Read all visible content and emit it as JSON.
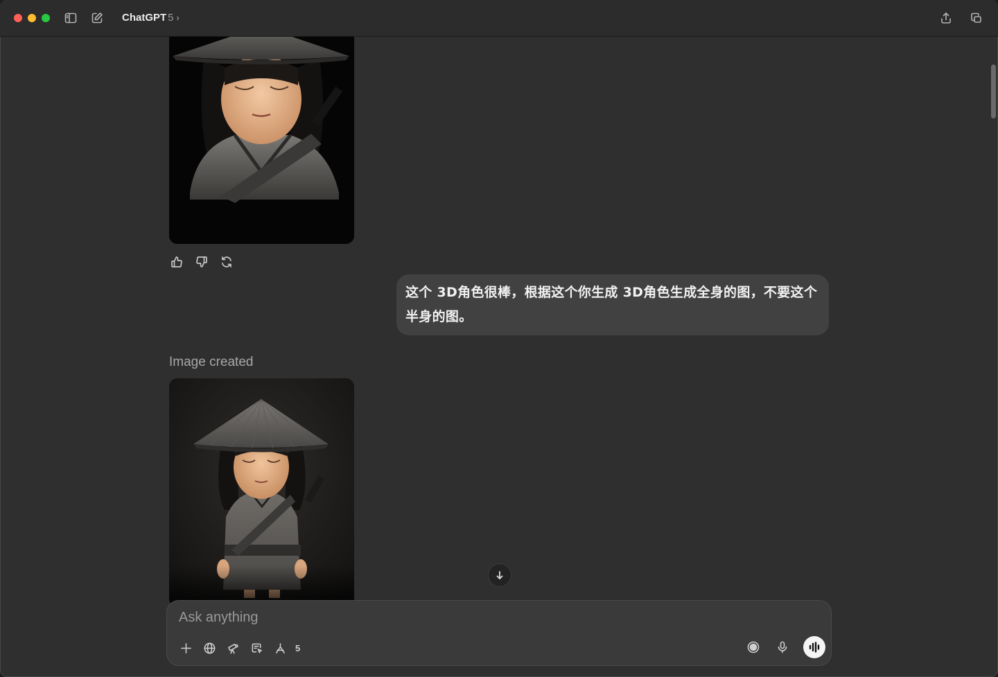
{
  "titlebar": {
    "model_name": "ChatGPT",
    "model_version": "5",
    "chevron": "›"
  },
  "conversation": {
    "user_message": "这个 3D角色很棒，根据这个你生成 3D角色生成全身的图，不要这个半身的图。",
    "image_created_label": "Image created"
  },
  "composer": {
    "placeholder": "Ask anything",
    "tools_count_badge": "5"
  },
  "icons": {
    "sidebar_toggle": "sidebar-icon",
    "new_chat": "compose-icon",
    "share": "share-icon",
    "temporary_chat": "window-icon",
    "thumbs_up": "thumbs-up-icon",
    "thumbs_down": "thumbs-down-icon",
    "regenerate": "refresh-icon",
    "scroll_down": "arrow-down-icon",
    "plus": "plus-icon",
    "web_search": "globe-icon",
    "deep_research": "telescope-icon",
    "canvas": "canvas-icon",
    "tools": "tools-icon",
    "record": "record-icon",
    "mic": "mic-icon",
    "voice_mode": "voice-wave-icon"
  },
  "colors": {
    "traffic_red": "#ff5f57",
    "traffic_yellow": "#febc2e",
    "traffic_green": "#28c840",
    "background": "#2f2f2f",
    "bubble": "#414141",
    "composer": "#3a3a3a"
  }
}
